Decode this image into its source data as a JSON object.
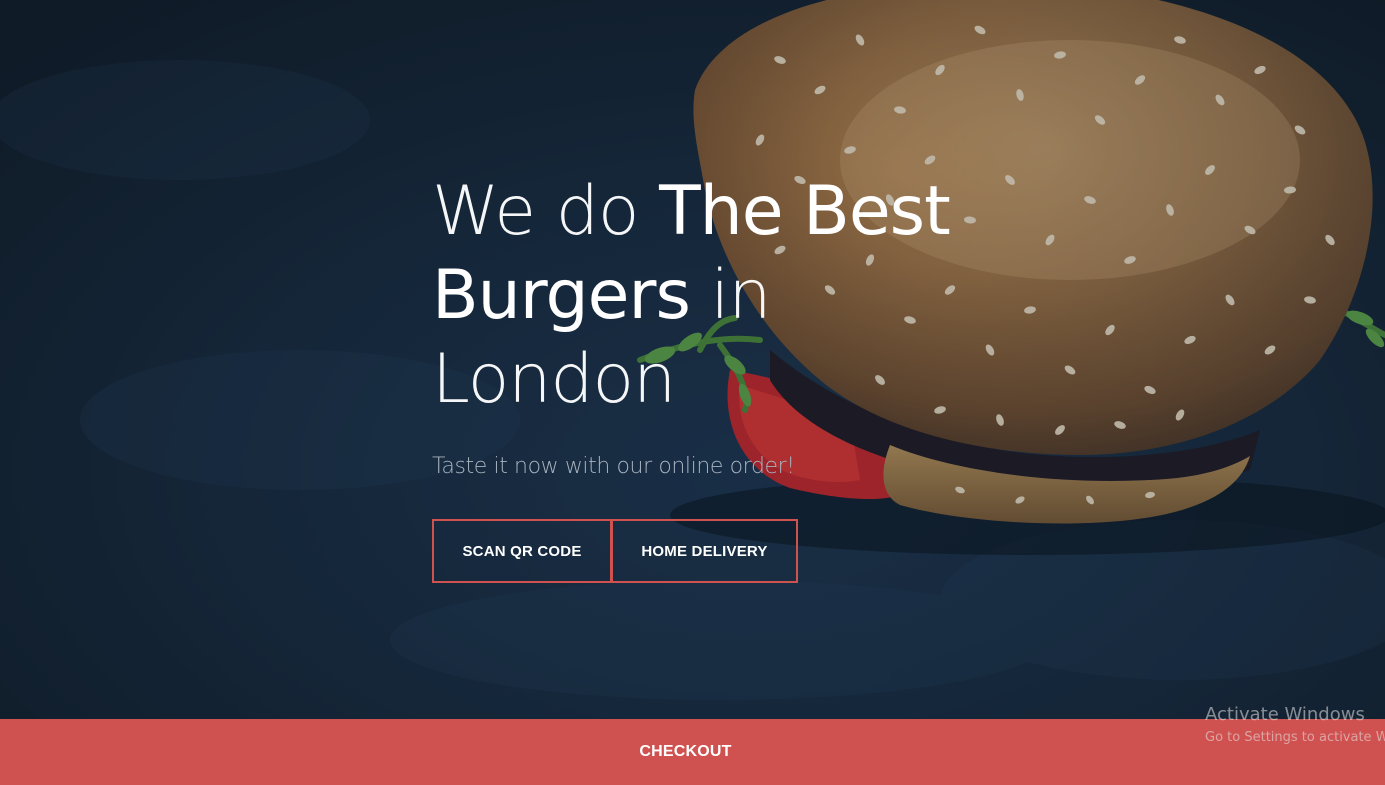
{
  "hero": {
    "headline": {
      "part1": "We do ",
      "part2": "The Best",
      "part3": "Burgers",
      "part4": " in",
      "part5": "London"
    },
    "tagline": "Taste it now with our online order!",
    "buttons": {
      "scan_qr": "Scan QR Code",
      "home_delivery": "Home Delivery"
    }
  },
  "checkout": {
    "label": "Checkout"
  },
  "os_watermark": {
    "title": "Activate Windows",
    "subtitle": "Go to Settings to activate Windows."
  },
  "colors": {
    "accent": "#d05250",
    "background": "#15222f",
    "text": "#ffffff",
    "tagline": "#a8b3bf"
  },
  "image": {
    "background_subject": "sesame-seed-burger-photo"
  }
}
